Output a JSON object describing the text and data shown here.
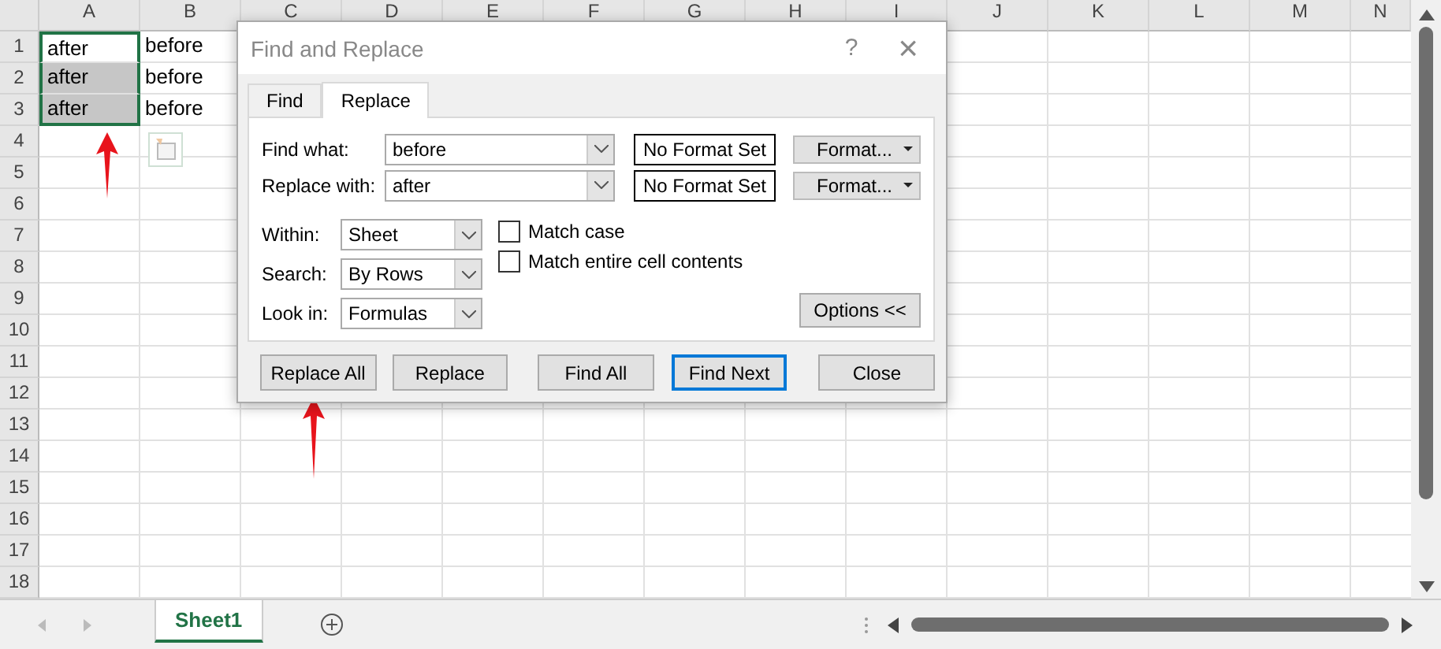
{
  "columns": [
    "A",
    "B",
    "C",
    "D",
    "E",
    "F",
    "G",
    "H",
    "I",
    "J",
    "K",
    "L",
    "M",
    "N"
  ],
  "rows": [
    {
      "number": "1",
      "cells": [
        {
          "text": "after",
          "selected": true,
          "active": true
        },
        {
          "text": "before",
          "selected": false
        }
      ]
    },
    {
      "number": "2",
      "cells": [
        {
          "text": "after",
          "selected": true,
          "active": false
        },
        {
          "text": "before",
          "selected": false
        }
      ]
    },
    {
      "number": "3",
      "cells": [
        {
          "text": "after",
          "selected": true,
          "active": false
        },
        {
          "text": "before",
          "selected": false
        }
      ]
    },
    {
      "number": "4",
      "cells": []
    },
    {
      "number": "5",
      "cells": []
    },
    {
      "number": "6",
      "cells": []
    },
    {
      "number": "7",
      "cells": []
    },
    {
      "number": "8",
      "cells": []
    },
    {
      "number": "9",
      "cells": []
    },
    {
      "number": "10",
      "cells": []
    },
    {
      "number": "11",
      "cells": []
    },
    {
      "number": "12",
      "cells": []
    },
    {
      "number": "13",
      "cells": []
    },
    {
      "number": "14",
      "cells": []
    },
    {
      "number": "15",
      "cells": []
    },
    {
      "number": "16",
      "cells": []
    },
    {
      "number": "17",
      "cells": []
    },
    {
      "number": "18",
      "cells": []
    }
  ],
  "dialog": {
    "title": "Find and Replace",
    "help": "?",
    "close": "×",
    "tabs": [
      {
        "label": "Find",
        "selected": false
      },
      {
        "label": "Replace",
        "selected": true
      }
    ],
    "find_what": {
      "label": "Find what:",
      "value": "before",
      "format_status": "No Format Set",
      "format_button": "Format..."
    },
    "replace_with": {
      "label": "Replace with:",
      "value": "after",
      "format_status": "No Format Set",
      "format_button": "Format..."
    },
    "options": [
      {
        "label": "Within:",
        "value": "Sheet"
      },
      {
        "label": "Search:",
        "value": "By Rows"
      },
      {
        "label": "Look in:",
        "value": "Formulas"
      }
    ],
    "checkboxes": [
      {
        "label": "Match case",
        "checked": false
      },
      {
        "label": "Match entire cell contents",
        "checked": false
      }
    ],
    "options_button": "Options <<",
    "buttons": [
      {
        "label": "Replace All",
        "default": false
      },
      {
        "label": "Replace",
        "default": false
      },
      {
        "label": "Find All",
        "default": false
      },
      {
        "label": "Find Next",
        "default": true
      },
      {
        "label": "Close",
        "default": false
      }
    ]
  },
  "sheet_tabs": [
    {
      "label": "Sheet1",
      "selected": true
    }
  ]
}
